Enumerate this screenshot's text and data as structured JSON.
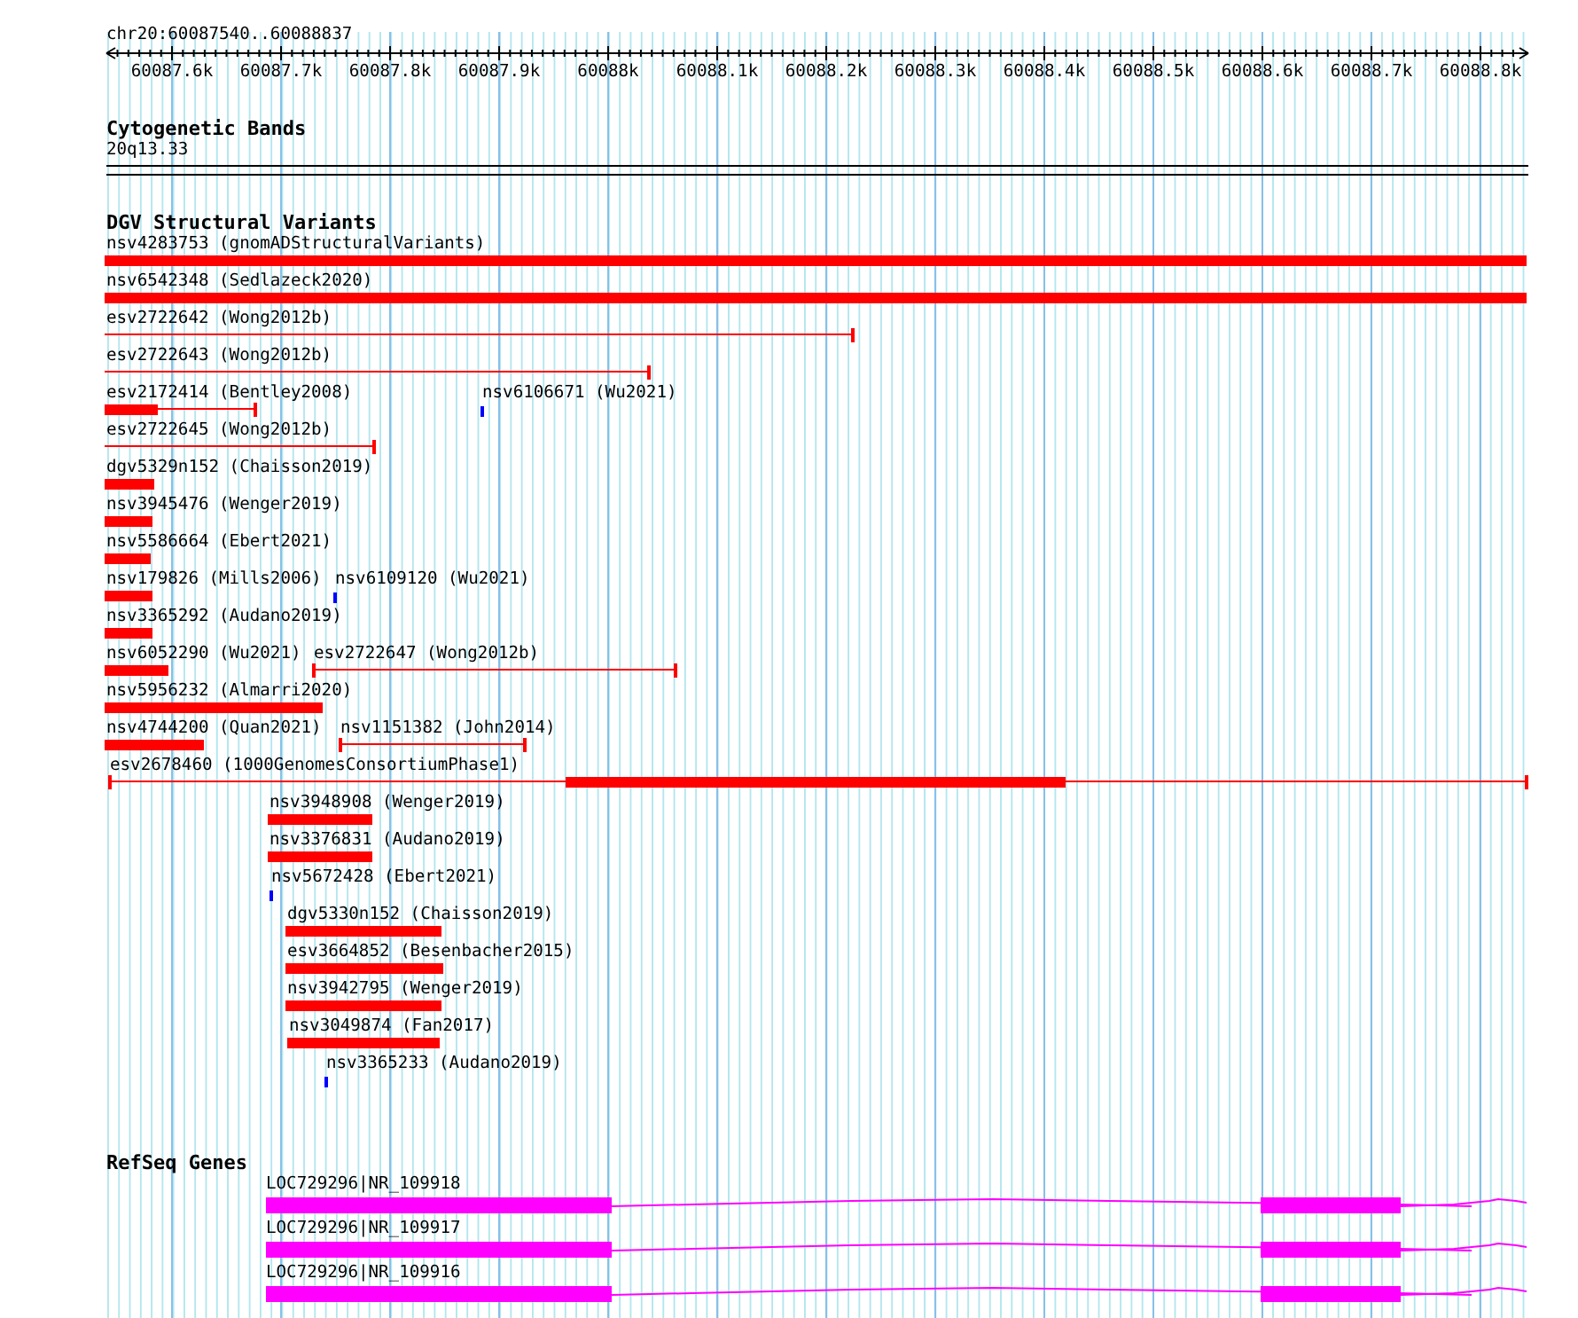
{
  "ruler": {
    "location": "chr20:60087540..60088837",
    "ticks": [
      "60087.6k",
      "60087.7k",
      "60087.8k",
      "60087.9k",
      "60088k",
      "60088.1k",
      "60088.2k",
      "60088.3k",
      "60088.4k",
      "60088.5k",
      "60088.6k",
      "60088.7k",
      "60088.8k"
    ]
  },
  "tracks": [
    {
      "kind": "bands",
      "title": "Cytogenetic Bands",
      "features": [
        {
          "label": "20q13.33"
        }
      ]
    },
    {
      "kind": "variants",
      "title": "DGV Structural Variants",
      "rows": [
        [
          {
            "label": "nsv4283753 (gnomADStructuralVariants)",
            "kind": "block"
          }
        ],
        [
          {
            "label": "nsv6542348 (Sedlazeck2020)",
            "kind": "block"
          }
        ],
        [
          {
            "label": "esv2722642 (Wong2012b)",
            "kind": "span"
          }
        ],
        [
          {
            "label": "esv2722643 (Wong2012b)",
            "kind": "span"
          }
        ],
        [
          {
            "label": "esv2172414 (Bentley2008)",
            "kind": "split"
          },
          {
            "label": "nsv6106671 (Wu2021)",
            "kind": "point"
          }
        ],
        [
          {
            "label": "esv2722645 (Wong2012b)",
            "kind": "span"
          }
        ],
        [
          {
            "label": "dgv5329n152 (Chaisson2019)",
            "kind": "block"
          }
        ],
        [
          {
            "label": "nsv3945476 (Wenger2019)",
            "kind": "block"
          }
        ],
        [
          {
            "label": "nsv5586664 (Ebert2021)",
            "kind": "block"
          }
        ],
        [
          {
            "label": "nsv179826 (Mills2006)",
            "kind": "block"
          },
          {
            "label": "nsv6109120 (Wu2021)",
            "kind": "point"
          }
        ],
        [
          {
            "label": "nsv3365292 (Audano2019)",
            "kind": "block"
          }
        ],
        [
          {
            "label": "nsv6052290 (Wu2021)",
            "kind": "block"
          },
          {
            "label": "esv2722647 (Wong2012b)",
            "kind": "span"
          }
        ],
        [
          {
            "label": "nsv5956232 (Almarri2020)",
            "kind": "block"
          }
        ],
        [
          {
            "label": "nsv4744200 (Quan2021)",
            "kind": "block"
          },
          {
            "label": "nsv1151382 (John2014)",
            "kind": "span"
          }
        ],
        [
          {
            "label": "esv2678460 (1000GenomesConsortiumPhase1)",
            "kind": "core"
          }
        ],
        [
          {
            "label": "nsv3948908 (Wenger2019)",
            "kind": "block"
          }
        ],
        [
          {
            "label": "nsv3376831 (Audano2019)",
            "kind": "block"
          }
        ],
        [
          {
            "label": "nsv5672428 (Ebert2021)",
            "kind": "point"
          }
        ],
        [
          {
            "label": "dgv5330n152 (Chaisson2019)",
            "kind": "block"
          }
        ],
        [
          {
            "label": "esv3664852 (Besenbacher2015)",
            "kind": "block"
          }
        ],
        [
          {
            "label": "nsv3942795 (Wenger2019)",
            "kind": "block"
          }
        ],
        [
          {
            "label": "nsv3049874 (Fan2017)",
            "kind": "block"
          }
        ],
        [
          {
            "label": "nsv3365233 (Audano2019)",
            "kind": "point"
          }
        ]
      ]
    },
    {
      "kind": "genes",
      "title": "RefSeq Genes",
      "features": [
        {
          "label": "LOC729296|NR_109918"
        },
        {
          "label": "LOC729296|NR_109917"
        },
        {
          "label": "LOC729296|NR_109916"
        }
      ]
    }
  ]
}
